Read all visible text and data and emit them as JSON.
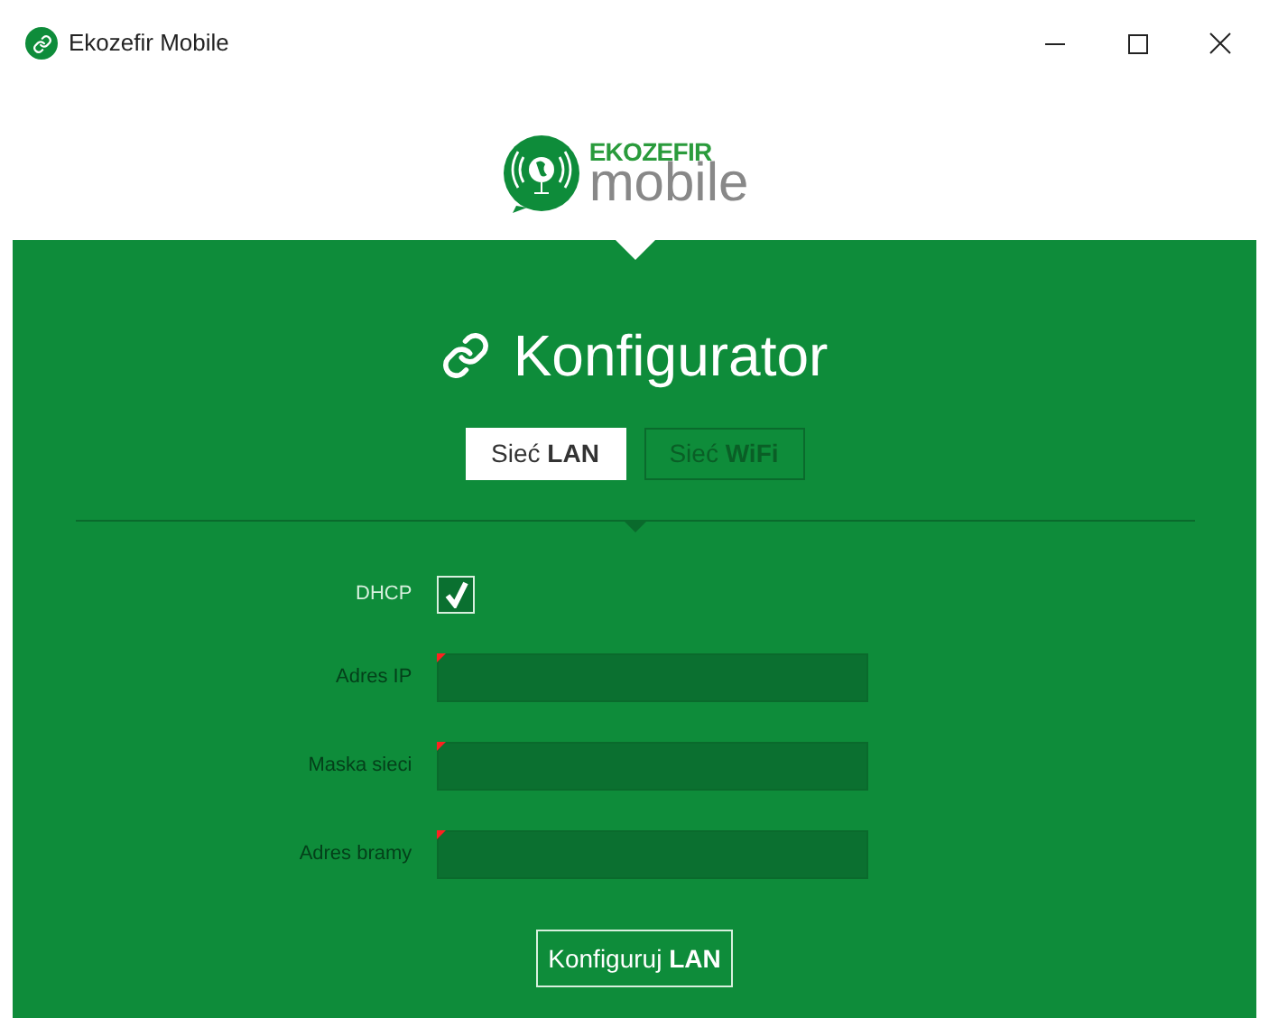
{
  "window": {
    "title": "Ekozefir Mobile"
  },
  "logo": {
    "brand": "EKOZEFIR",
    "product": "mobile"
  },
  "heading": "Konfigurator",
  "tabs": [
    {
      "label": "Sieć **LAN**",
      "selected": true
    },
    {
      "label": "Sieć **WiFi**",
      "selected": false
    }
  ],
  "dhcp": {
    "label": "DHCP",
    "checked": true
  },
  "fields": [
    {
      "label": "Adres IP",
      "disabled": true,
      "invalid": true
    },
    {
      "label": "Maska sieci",
      "disabled": true,
      "invalid": true
    },
    {
      "label": "Adres bramy",
      "disabled": true,
      "invalid": true
    }
  ],
  "submit": "Konfiguruj **LAN**"
}
